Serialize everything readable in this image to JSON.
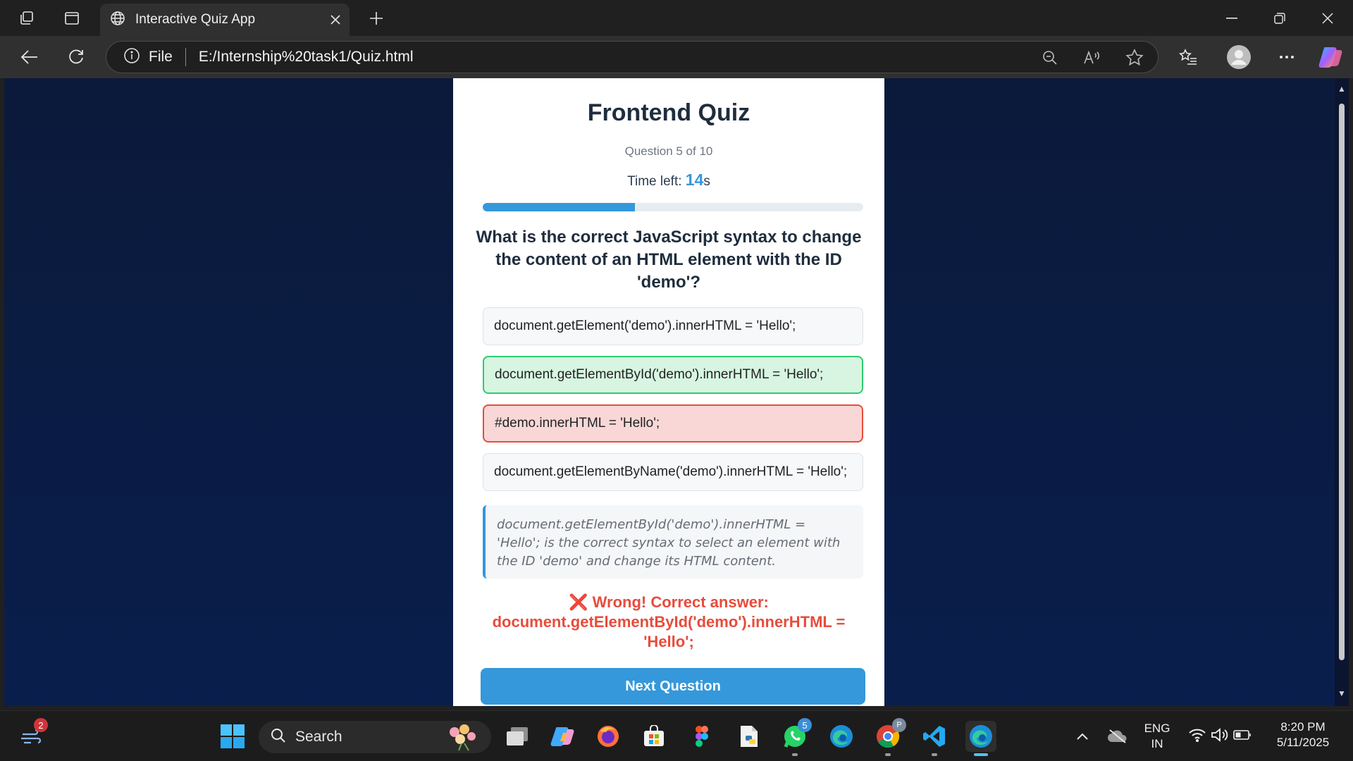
{
  "browser": {
    "tab_title": "Interactive Quiz App",
    "address_scheme": "File",
    "url": "E:/Internship%20task1/Quiz.html"
  },
  "quiz": {
    "title": "Frontend Quiz",
    "question_counter": "Question 5 of 10",
    "timer_label": "Time left: ",
    "timer_value": "14",
    "timer_unit": "s",
    "progress_fraction": 0.4,
    "question": "What is the correct JavaScript syntax to change the content of an HTML element with the ID 'demo'?",
    "options": [
      {
        "text": "document.getElement('demo').innerHTML = 'Hello';",
        "state": "neutral"
      },
      {
        "text": "document.getElementById('demo').innerHTML = 'Hello';",
        "state": "correct"
      },
      {
        "text": "#demo.innerHTML = 'Hello';",
        "state": "wrong"
      },
      {
        "text": "document.getElementByName('demo').innerHTML = 'Hello';",
        "state": "neutral"
      }
    ],
    "explanation": "document.getElementById('demo').innerHTML = 'Hello'; is the correct syntax to select an element with the ID 'demo' and change its HTML content.",
    "feedback": "❌ Wrong! Correct answer: document.getElementById('demo').innerHTML = 'Hello';",
    "next_button": "Next Question"
  },
  "taskbar": {
    "widgets_badge": "2",
    "search_placeholder": "Search",
    "whatsapp_badge": "5",
    "language_line1": "ENG",
    "language_line2": "IN",
    "time": "8:20 PM",
    "date": "5/11/2025"
  },
  "colors": {
    "accent": "#3498db",
    "correct": "#2ecc71",
    "wrong": "#e74c3c"
  }
}
